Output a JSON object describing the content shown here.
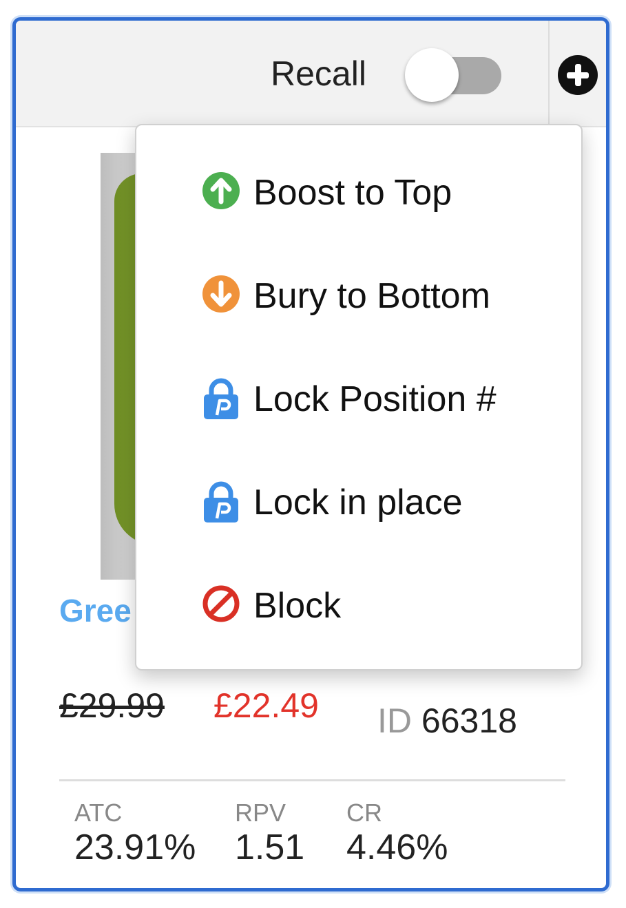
{
  "header": {
    "recall_label": "Recall",
    "recall_toggle_on": false
  },
  "product": {
    "title": "Gree",
    "price_old": "£29.99",
    "price_new": "£22.49",
    "id_label": "ID",
    "id_value": "66318"
  },
  "metrics": [
    {
      "label": "ATC",
      "value": "23.91%"
    },
    {
      "label": "RPV",
      "value": "1.51"
    },
    {
      "label": "CR",
      "value": "4.46%"
    }
  ],
  "menu": {
    "items": [
      {
        "label": "Boost to Top",
        "icon": "arrow-up-circle-icon",
        "color": "#4caf50"
      },
      {
        "label": "Bury to Bottom",
        "icon": "arrow-down-circle-icon",
        "color": "#f0923a"
      },
      {
        "label": "Lock Position #",
        "icon": "padlock-p-icon",
        "color": "#3d8ee6"
      },
      {
        "label": "Lock in place",
        "icon": "padlock-p-icon",
        "color": "#3d8ee6"
      },
      {
        "label": "Block",
        "icon": "block-icon",
        "color": "#d93025"
      }
    ]
  },
  "colors": {
    "card_border": "#2f6bd0",
    "title_blue": "#5aaaf0",
    "sale_red": "#e2332a"
  }
}
